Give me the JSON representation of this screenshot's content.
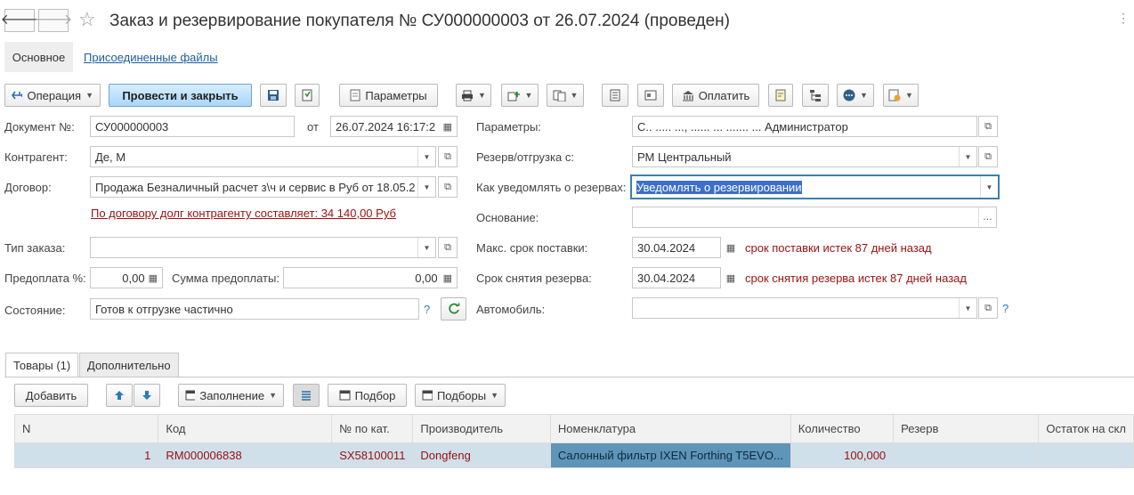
{
  "window": {
    "title": "Заказ и резервирование покупателя № СУ000000003 от 26.07.2024 (проведен)",
    "back_glyph": "🡐",
    "forward_glyph": "🡒",
    "star_glyph": "☆",
    "more_glyph": "⋮"
  },
  "section_tabs": {
    "main": "Основное",
    "files": "Присоединенные файлы"
  },
  "toolbar": {
    "operation": "Операция",
    "post_and_close": "Провести и закрыть",
    "parameters": "Параметры",
    "pay": "Оплатить"
  },
  "form": {
    "doc_number_label": "Документ №:",
    "doc_number": "СУ000000003",
    "from_label": "от",
    "doc_date": "26.07.2024 16:17:2",
    "counterparty_label": "Контрагент:",
    "counterparty": "Де,       М",
    "contract_label": "Договор:",
    "contract": "Продажа Безналичный расчет з\\ч и сервис в Руб от 18.05.2",
    "debt_note": "По договору долг контрагенту составляет: 34 140,00 Руб",
    "order_type_label": "Тип заказа:",
    "order_type": "",
    "prepay_pct_label": "Предоплата %:",
    "prepay_pct": "0,00",
    "prepay_sum_label": "Сумма предоплаты:",
    "prepay_sum": "0,00",
    "state_label": "Состояние:",
    "state": "Готов к отгрузке частично",
    "params_label": "Параметры:",
    "params": "С.. ..... ..., ...... ... ....... ... Администратор",
    "reserve_from_label": "Резерв/отгрузка с:",
    "reserve_from": "РМ Центральный",
    "notify_label": "Как уведомлять о резервах:",
    "notify": "Уведомлять о резервировании",
    "basis_label": "Основание:",
    "basis": "",
    "max_delivery_label": "Макс. срок поставки:",
    "max_delivery": "30.04.2024",
    "max_delivery_note": "срок поставки истек 87 дней назад",
    "reserve_removal_label": "Срок снятия резерва:",
    "reserve_removal": "30.04.2024",
    "reserve_removal_note": "срок снятия резерва истек 87 дней назад",
    "car_label": "Автомобиль:",
    "car": "",
    "help": "?"
  },
  "lower_tabs": {
    "goods": "Товары (1)",
    "additional": "Дополнительно"
  },
  "goods_toolbar": {
    "add": "Добавить",
    "fill": "Заполнение",
    "selection": "Подбор",
    "selections": "Подборы"
  },
  "table": {
    "columns": [
      "N",
      "Код",
      "№ по кат.",
      "Производитель",
      "Номенклатура",
      "Количество",
      "Резерв",
      "Остаток на скл"
    ],
    "rows": [
      [
        "1",
        "RM000006838",
        "SX58100011",
        "Dongfeng",
        "Салонный фильтр IXEN Forthing T5EVO...",
        "100,000",
        "",
        ""
      ]
    ]
  },
  "colors": {
    "accent_blue": "#3e7fa8",
    "warning_red": "#9b1010",
    "row_highlight": "#cfe0ea",
    "selected_cell": "#5e95b8"
  }
}
